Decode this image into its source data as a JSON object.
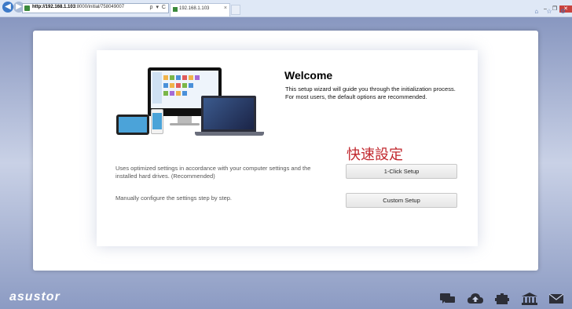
{
  "browser": {
    "url_host": "http://192.168.1.103",
    "url_rest": ":8000/initial/758049007",
    "tab_title": "192.168.1.103",
    "tools": "ρ ▾ C",
    "win_controls": [
      "–",
      "❐",
      "✕"
    ],
    "right_icons": "⌂ ☆ ⚙"
  },
  "wizard": {
    "title": "Welcome",
    "description": "This setup wizard will guide you through the initialization process. For most users, the default options are recommended.",
    "annotation": "快速設定",
    "options": [
      {
        "text": "Uses optimized settings in accordance with your computer settings and the installed hard drives. (Recommended)",
        "button": "1-Click Setup"
      },
      {
        "text": "Manually configure the settings step by step.",
        "button": "Custom Setup"
      }
    ]
  },
  "footer": {
    "logo": "asustor",
    "dock_icons": [
      "chat-icon",
      "cloud-upload-icon",
      "puzzle-icon",
      "bank-icon",
      "mail-icon"
    ]
  }
}
